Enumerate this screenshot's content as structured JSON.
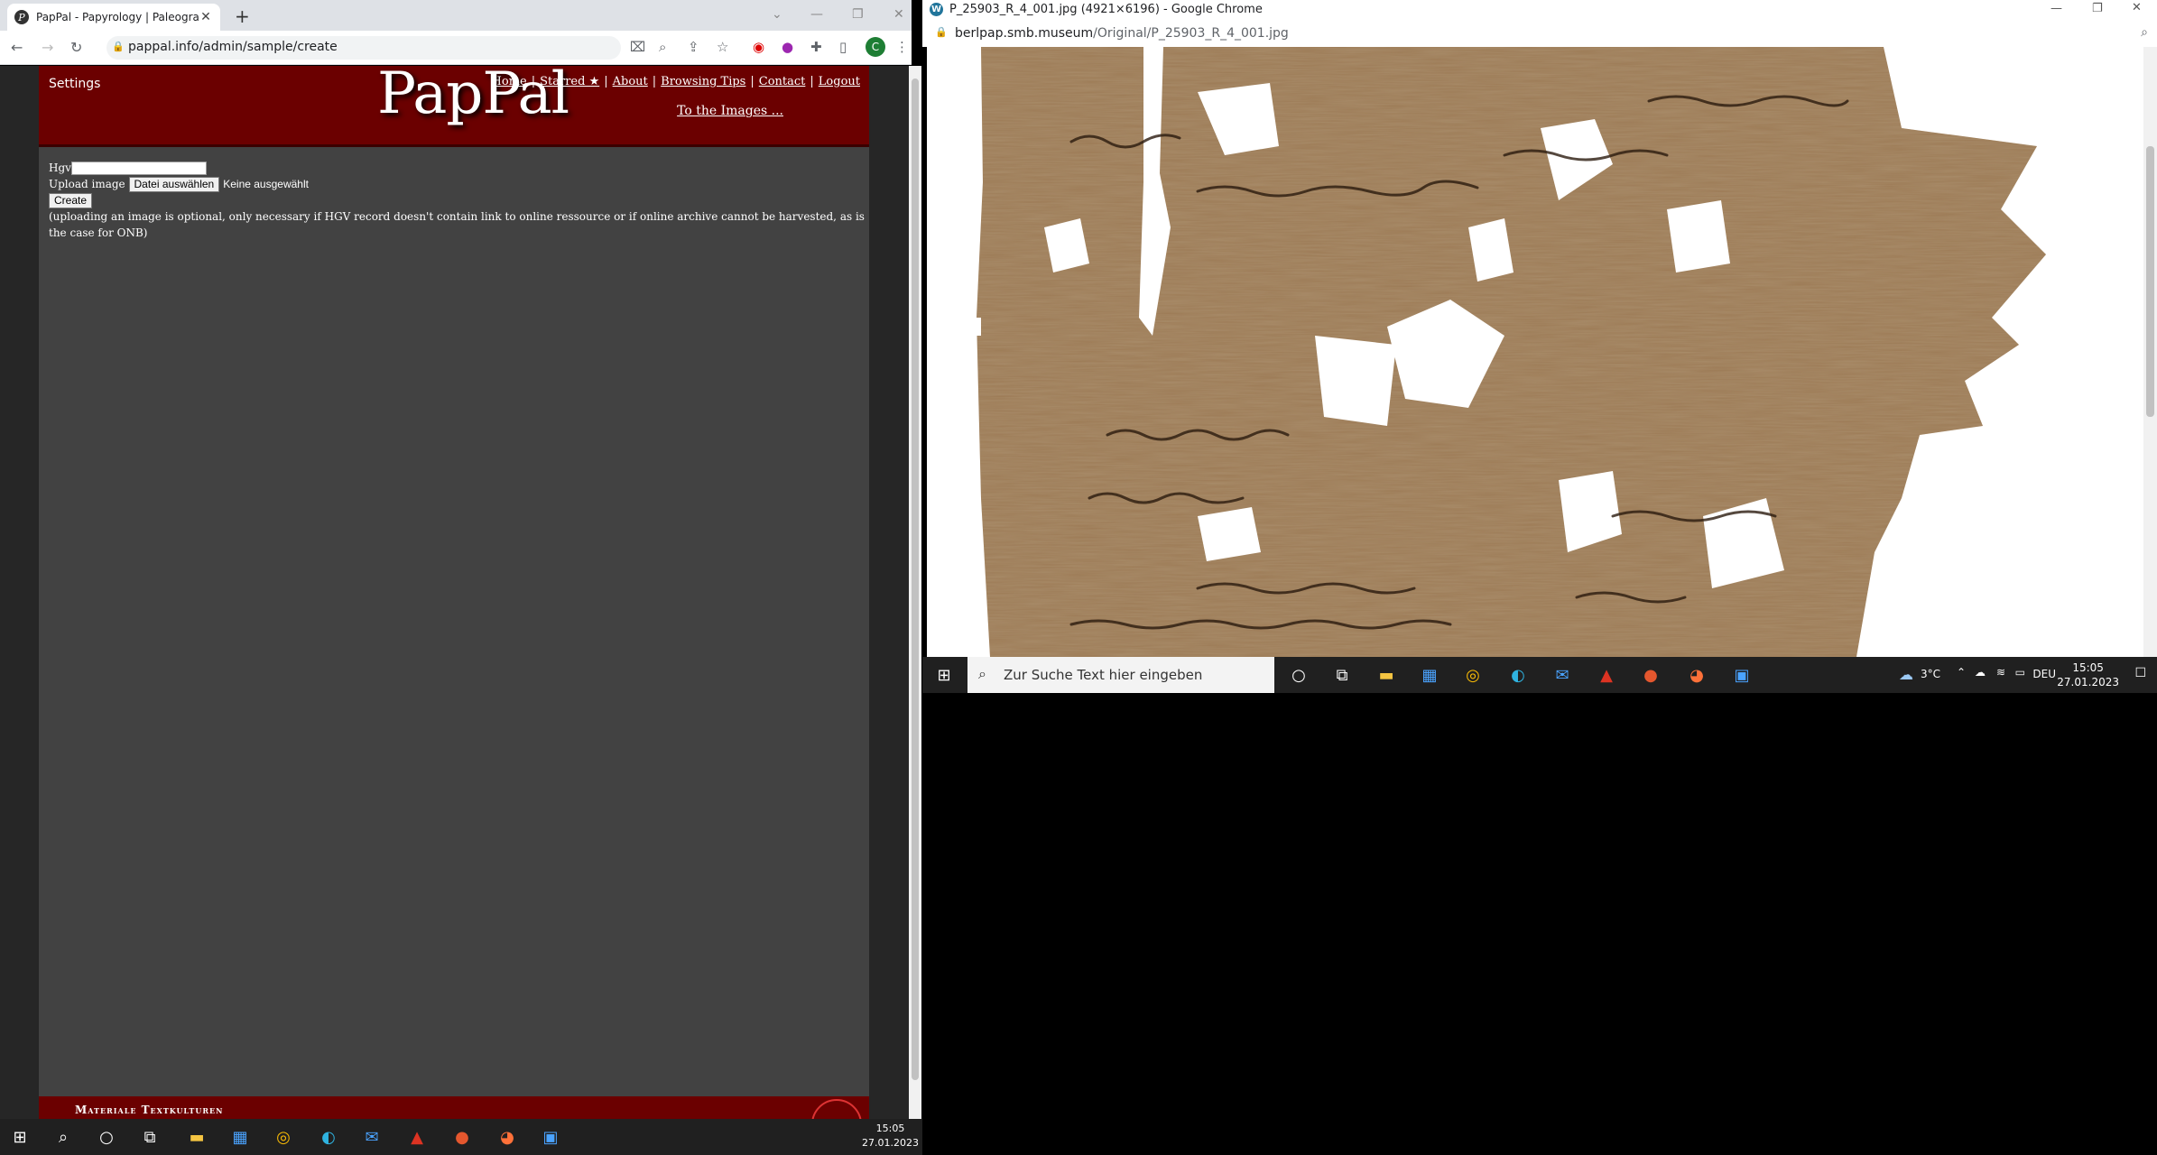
{
  "left_window": {
    "tab_title": "PapPal - Papyrology | Paleograph",
    "url": "pappal.info/admin/sample/create",
    "profile_initial": "C",
    "page": {
      "settings_label": "Settings",
      "logo": "PapPal",
      "nav": [
        "Home",
        "Starred ★",
        "About",
        "Browsing Tips",
        "Contact",
        "Logout"
      ],
      "to_images": "To the Images ...",
      "form": {
        "hgv_label": "Hgv",
        "upload_label": "Upload image",
        "file_button": "Datei auswählen",
        "no_file": "Keine ausgewählt",
        "create_button": "Create",
        "note": "(uploading an image is optional, only necessary if HGV record doesn't contain link to online ressource or if online archive cannot be harvested, as is the case for ONB)"
      },
      "footer_text": "Materiale Textkulturen"
    },
    "taskbar": {
      "time": "15:05",
      "date": "27.01.2023"
    }
  },
  "right_window": {
    "title": "P_25903_R_4_001.jpg (4921×6196) - Google Chrome",
    "url_host": "berlpap.smb.museum",
    "url_path": "/Original/P_25903_R_4_001.jpg",
    "taskbar": {
      "search_placeholder": "Zur Suche Text hier eingeben",
      "weather": "3°C",
      "lang": "DEU",
      "time": "15:05",
      "date": "27.01.2023"
    }
  },
  "colors": {
    "header_red": "#6b0000",
    "page_gray": "#424242",
    "papyrus": "#9c7a55"
  },
  "icons": {
    "taskbar": [
      "windows-icon",
      "search-icon",
      "cortana-icon",
      "task-view-icon",
      "explorer-icon",
      "store-icon",
      "chrome-icon",
      "edge-icon",
      "mail-icon",
      "acrobat-icon",
      "powerpoint-icon",
      "firefox-icon",
      "photos-icon"
    ]
  }
}
